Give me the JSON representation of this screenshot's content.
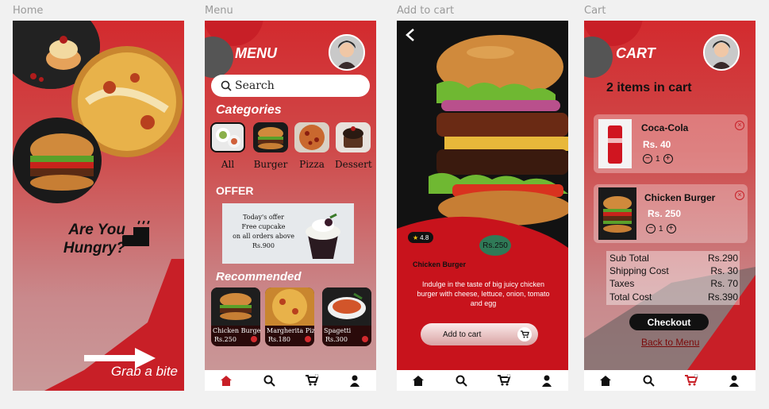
{
  "labels": {
    "home": "Home",
    "menu": "Menu",
    "add_to_cart": "Add to cart",
    "cart": "Cart"
  },
  "home": {
    "title_line1": "Are You",
    "title_line2": "Hungry?",
    "cta": "Grab a bite"
  },
  "menu": {
    "title": "MENU",
    "search_placeholder": "Search",
    "categories_title": "Categories",
    "categories": [
      "All",
      "Burger",
      "Pizza",
      "Dessert"
    ],
    "offer_title": "OFFER",
    "offer_text": [
      "Today's offer",
      "Free cupcake",
      "on all orders above",
      "Rs.900"
    ],
    "recommended_title": "Recommended",
    "recommended": [
      {
        "name": "Chicken Burger",
        "price": "Rs.250"
      },
      {
        "name": "Margherita Pizza",
        "price": "Rs.180"
      },
      {
        "name": "Spagetti",
        "price": "Rs.300"
      }
    ]
  },
  "detail": {
    "rating": "4.8",
    "price": "Rs.250",
    "name": "Chicken Burger",
    "description": "Indulge in the taste of big juicy chicken burger with cheese, lettuce, onion, tomato and egg",
    "add_button": "Add to cart"
  },
  "cart": {
    "title": "CART",
    "count_text": "2 items in cart",
    "items": [
      {
        "name": "Coca-Cola",
        "price": "Rs. 40",
        "qty": "1"
      },
      {
        "name": "Chicken Burger",
        "price": "Rs. 250",
        "qty": "1"
      }
    ],
    "totals": [
      {
        "label": "Sub Total",
        "value": "Rs.290"
      },
      {
        "label": "Shipping Cost",
        "value": "Rs. 30"
      },
      {
        "label": "Taxes",
        "value": "Rs. 70"
      },
      {
        "label": "Total Cost",
        "value": "Rs.390"
      }
    ],
    "checkout": "Checkout",
    "back_link": "Back to Menu"
  },
  "colors": {
    "accent": "#d32a2e",
    "dark": "#111111"
  }
}
